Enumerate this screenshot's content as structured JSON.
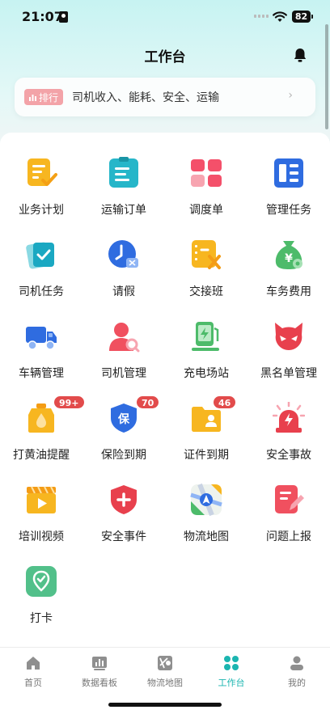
{
  "status": {
    "time": "21:07",
    "battery": "82"
  },
  "header": {
    "title": "工作台"
  },
  "ranking": {
    "badge": "排行",
    "text": "司机收入、能耗、安全、运输"
  },
  "grid": [
    {
      "label": "业务计划",
      "icon": "business-plan-icon",
      "badge": ""
    },
    {
      "label": "运输订单",
      "icon": "transport-order-icon",
      "badge": ""
    },
    {
      "label": "调度单",
      "icon": "dispatch-icon",
      "badge": ""
    },
    {
      "label": "管理任务",
      "icon": "manage-task-icon",
      "badge": ""
    },
    {
      "label": "司机任务",
      "icon": "driver-task-icon",
      "badge": ""
    },
    {
      "label": "请假",
      "icon": "leave-icon",
      "badge": ""
    },
    {
      "label": "交接班",
      "icon": "shift-handover-icon",
      "badge": ""
    },
    {
      "label": "车务费用",
      "icon": "vehicle-cost-icon",
      "badge": ""
    },
    {
      "label": "车辆管理",
      "icon": "truck-icon",
      "badge": ""
    },
    {
      "label": "司机管理",
      "icon": "driver-manage-icon",
      "badge": ""
    },
    {
      "label": "充电场站",
      "icon": "charging-station-icon",
      "badge": ""
    },
    {
      "label": "黑名单管理",
      "icon": "blacklist-icon",
      "badge": ""
    },
    {
      "label": "打黄油提醒",
      "icon": "grease-icon",
      "badge": "99+"
    },
    {
      "label": "保险到期",
      "icon": "insurance-icon",
      "badge": "70"
    },
    {
      "label": "证件到期",
      "icon": "certificate-icon",
      "badge": "46"
    },
    {
      "label": "安全事故",
      "icon": "alarm-icon",
      "badge": ""
    },
    {
      "label": "培训视频",
      "icon": "training-video-icon",
      "badge": ""
    },
    {
      "label": "安全事件",
      "icon": "safety-shield-icon",
      "badge": ""
    },
    {
      "label": "物流地图",
      "icon": "map-icon",
      "badge": ""
    },
    {
      "label": "问题上报",
      "icon": "report-icon",
      "badge": ""
    },
    {
      "label": "打卡",
      "icon": "checkin-icon",
      "badge": ""
    }
  ],
  "tabs": [
    {
      "label": "首页",
      "icon": "home-icon"
    },
    {
      "label": "数据看板",
      "icon": "dashboard-icon"
    },
    {
      "label": "物流地图",
      "icon": "map-icon"
    },
    {
      "label": "工作台",
      "icon": "workbench-icon",
      "active": true
    },
    {
      "label": "我的",
      "icon": "profile-icon"
    }
  ],
  "colors": {
    "accent": "#1bb5b0",
    "badge": "#e24b4b"
  }
}
